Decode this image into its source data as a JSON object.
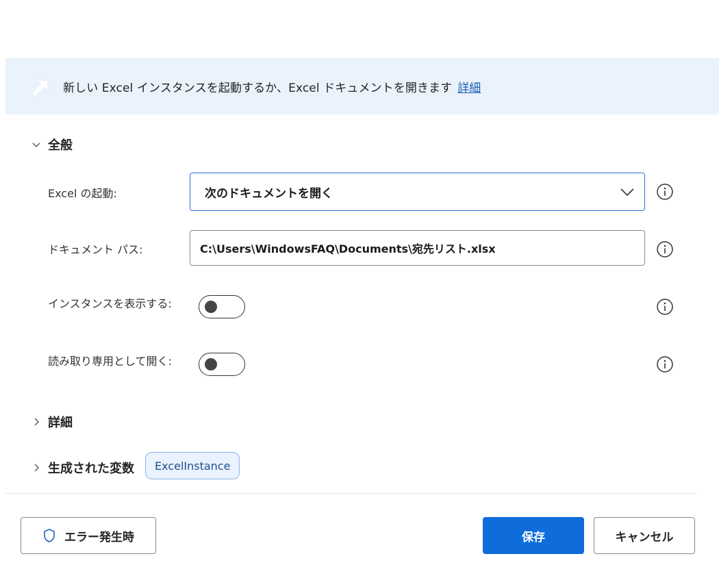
{
  "banner": {
    "icon": "arrow-up-right-icon",
    "text": "新しい Excel インスタンスを起動するか、Excel ドキュメントを開きます",
    "link": "詳細"
  },
  "sections": {
    "general": {
      "label": "全般",
      "expanded": true
    },
    "details": {
      "label": "詳細",
      "expanded": false
    },
    "variables": {
      "label": "生成された変数",
      "expanded": false,
      "chip": "ExcelInstance"
    }
  },
  "fields": {
    "launch": {
      "label": "Excel の起動:",
      "value": "次のドキュメントを開く"
    },
    "document_path": {
      "label": "ドキュメント パス:",
      "value": "C:\\Users\\WindowsFAQ\\Documents\\宛先リスト.xlsx"
    },
    "show_instance": {
      "label": "インスタンスを表示する:",
      "checked": false
    },
    "read_only": {
      "label": "読み取り専用として開く:",
      "checked": false
    }
  },
  "footer": {
    "error_button": "エラー発生時",
    "save_button": "保存",
    "cancel_button": "キャンセル"
  },
  "colors": {
    "accent": "#0f6cdb",
    "banner_bg": "#eaf2fb",
    "chip_bg": "#e9f2fd"
  }
}
